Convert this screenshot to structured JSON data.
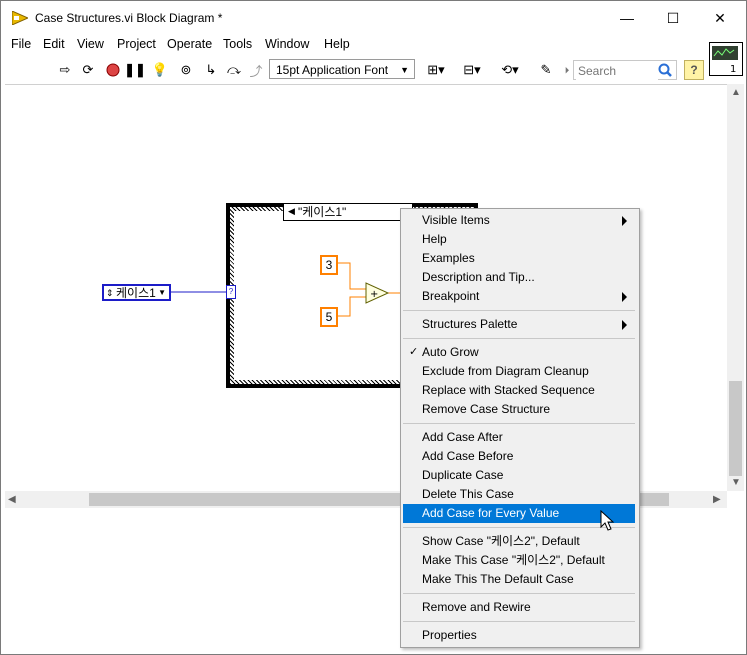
{
  "window": {
    "title": "Case Structures.vi Block Diagram *",
    "controls": {
      "minimize": "—",
      "maximize": "☐",
      "close": "✕"
    }
  },
  "menubar": [
    "File",
    "Edit",
    "View",
    "Project",
    "Operate",
    "Tools",
    "Window",
    "Help"
  ],
  "toolbar": {
    "font": "15pt Application Font",
    "search_placeholder": "Search",
    "help": "?"
  },
  "diagram": {
    "case_selector": "\"케이스1\"",
    "enum_constant": "케이스1",
    "constants": [
      "3",
      "5"
    ],
    "tunnel_label": "?"
  },
  "context_menu": {
    "items": [
      {
        "label": "Visible Items",
        "submenu": true
      },
      {
        "label": "Help"
      },
      {
        "label": "Examples"
      },
      {
        "label": "Description and Tip..."
      },
      {
        "label": "Breakpoint",
        "submenu": true
      },
      {
        "separator": true
      },
      {
        "label": "Structures Palette",
        "submenu": true
      },
      {
        "separator": true
      },
      {
        "label": "Auto Grow",
        "checked": true
      },
      {
        "label": "Exclude from Diagram Cleanup"
      },
      {
        "label": "Replace with Stacked Sequence"
      },
      {
        "label": "Remove Case Structure"
      },
      {
        "separator": true
      },
      {
        "label": "Add Case After"
      },
      {
        "label": "Add Case Before"
      },
      {
        "label": "Duplicate Case"
      },
      {
        "label": "Delete This Case"
      },
      {
        "label": "Add Case for Every Value",
        "highlighted": true
      },
      {
        "separator": true
      },
      {
        "label": "Show Case \"케이스2\", Default"
      },
      {
        "label": "Make This Case \"케이스2\", Default"
      },
      {
        "label": "Make This The Default Case"
      },
      {
        "separator": true
      },
      {
        "label": "Remove and Rewire"
      },
      {
        "separator": true
      },
      {
        "label": "Properties"
      }
    ]
  },
  "colors": {
    "highlight": "#0078d7",
    "enum_border": "#1c1cc8",
    "numeric_border": "#ff8000"
  }
}
